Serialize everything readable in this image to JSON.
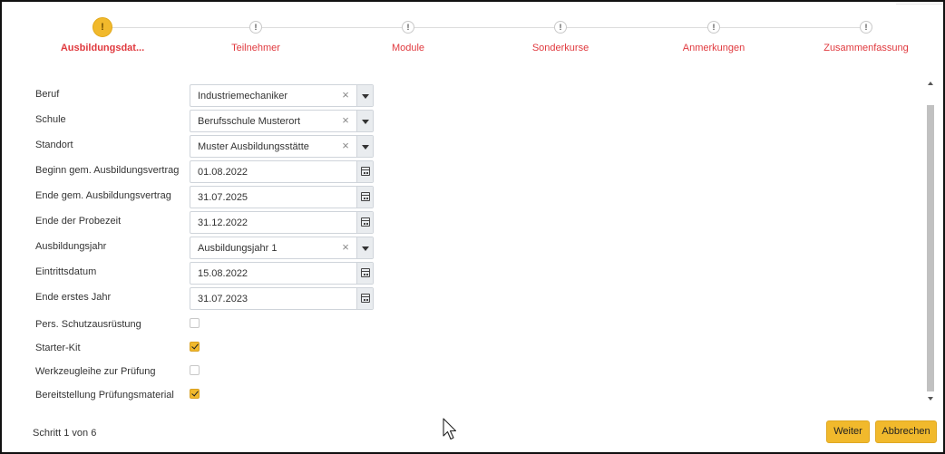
{
  "steps": [
    {
      "label": "Ausbildungsdat...",
      "icon": "!",
      "active": true
    },
    {
      "label": "Teilnehmer",
      "icon": "!"
    },
    {
      "label": "Module",
      "icon": "!"
    },
    {
      "label": "Sonderkurse",
      "icon": "!"
    },
    {
      "label": "Anmerkungen",
      "icon": "!"
    },
    {
      "label": "Zusammenfassung",
      "icon": "!"
    }
  ],
  "form": {
    "beruf": {
      "label": "Beruf",
      "value": "Industriemechaniker",
      "clear": "×"
    },
    "schule": {
      "label": "Schule",
      "value": "Berufsschule Musterort",
      "clear": "×"
    },
    "standort": {
      "label": "Standort",
      "value": "Muster Ausbildungsstätte",
      "clear": "×"
    },
    "beginn": {
      "label": "Beginn gem. Ausbildungsvertrag",
      "value": "01.08.2022"
    },
    "ende": {
      "label": "Ende gem. Ausbildungsvertrag",
      "value": "31.07.2025"
    },
    "probezeit": {
      "label": "Ende der Probezeit",
      "value": "31.12.2022"
    },
    "ausbildungsjahr": {
      "label": "Ausbildungsjahr",
      "value": "Ausbildungsjahr 1",
      "clear": "×"
    },
    "eintritt": {
      "label": "Eintrittsdatum",
      "value": "15.08.2022"
    },
    "ersteJahr": {
      "label": "Ende erstes Jahr",
      "value": "31.07.2023"
    },
    "schutz": {
      "label": "Pers. Schutzausrüstung",
      "checked": false
    },
    "starter": {
      "label": "Starter-Kit",
      "checked": true
    },
    "werkzeug": {
      "label": "Werkzeugleihe zur Prüfung",
      "checked": false
    },
    "pruefmat": {
      "label": "Bereitstellung Prüfungsmaterial",
      "checked": true
    }
  },
  "footer": {
    "step_text": "Schritt 1 von 6",
    "next_label": "Weiter",
    "cancel_label": "Abbrechen"
  },
  "colors": {
    "accent": "#f1b92c",
    "step_label": "#e0393e"
  }
}
